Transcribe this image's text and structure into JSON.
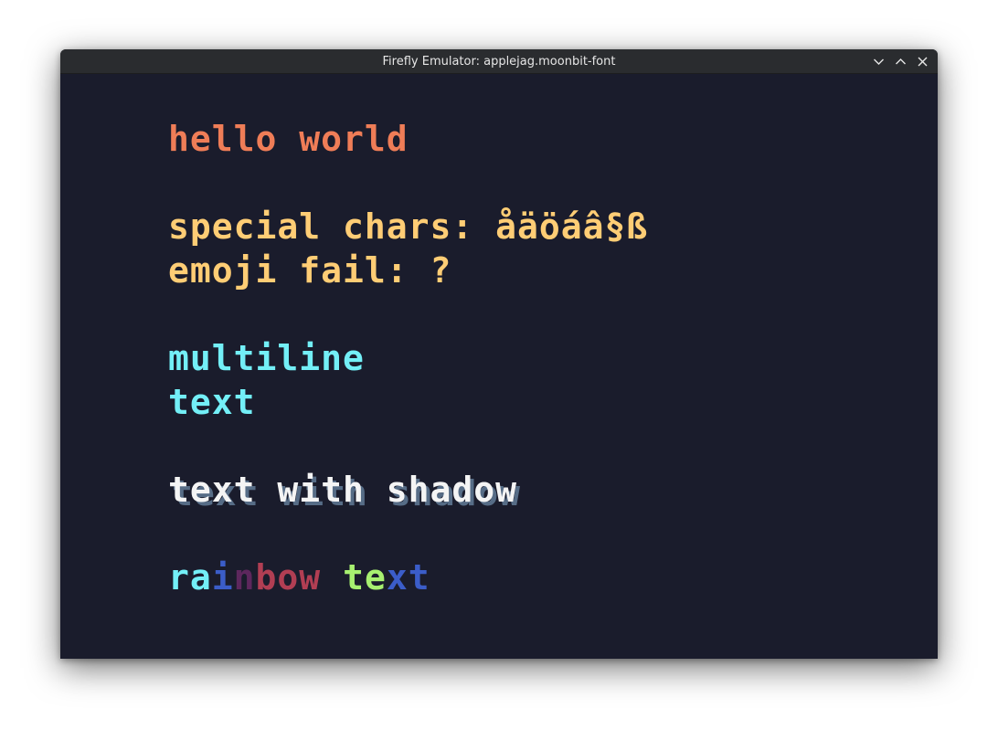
{
  "window": {
    "title": "Firefly Emulator: applejag.moonbit-font",
    "buttons": {
      "minimize_icon": "chevron-down-icon",
      "maximize_icon": "chevron-up-icon",
      "close_icon": "close-icon"
    }
  },
  "screen": {
    "background": "#1a1c2c",
    "lines": [
      {
        "text": "hello world",
        "color": "#ef7d57"
      },
      {
        "text": "special chars: åäöáâ§ß",
        "color": "#ffcd75"
      },
      {
        "text": "emoji fail: ?",
        "color": "#ffcd75"
      },
      {
        "text": "multiline",
        "color": "#73eff7"
      },
      {
        "text": "text",
        "color": "#73eff7"
      },
      {
        "text": "text with shadow",
        "color": "#f4f4f4",
        "shadow_color": "#566c86"
      }
    ],
    "rainbow": {
      "segments": [
        {
          "text": "ra",
          "color": "#73eff7"
        },
        {
          "text": "i",
          "color": "#3b5dc9"
        },
        {
          "text": "n",
          "color": "#5d275d"
        },
        {
          "text": "bow",
          "color": "#b13e53"
        },
        {
          "text": " ",
          "color": "#b13e53"
        },
        {
          "text": "te",
          "color": "#a7f070"
        },
        {
          "text": "xt",
          "color": "#3b5dc9"
        }
      ]
    }
  }
}
